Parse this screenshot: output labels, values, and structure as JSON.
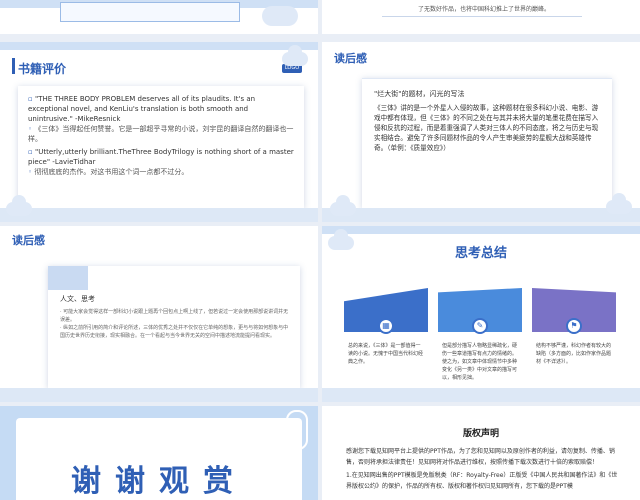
{
  "slides": {
    "top_right": {
      "text": "了无数好作品，也将中国科幻推上了世界的巅峰。"
    },
    "book_review": {
      "title": "书籍评价",
      "logo": "LOGO",
      "quote1_en": "\"THE THREE BODY PROBLEM deserves all of its plaudits. It's an exceptional novel, and KenLiu's translation is both smooth and unintrusive.\"   -MikeResnick",
      "quote1_cn": "《三体》当得起任何赞誉。它是一部超乎寻常的小说，刘宇昆的翻译自然的翻译也一样。",
      "quote2_en": "\"Utterly,utterly brilliant.TheThree BodyTrilogy is nothing short of a master piece\"      -LavieTidhar",
      "quote2_cn": "彻彻底底的杰作。对这书用这个词一点都不过分。"
    },
    "reading_1": {
      "title": "读后感",
      "head": "\"烂大街\"的题材，闪光的写法",
      "body": "《三体》讲的是一个外星人入侵的故事，这种题材在很多科幻小说、电影、游戏中都有体现，但《三体》的不同之处在与其并未将大量的笔墨花费在描写入侵和反抗的过程，而是着重强调了人类对三体人的不同态度，将之与历史与现实相结合。避免了许多同题材作品的令人产生审美疲劳的星舰大战和英雄传奇。（单例：《质量效应》）"
    },
    "reading_2": {
      "title": "读后感",
      "head": "人文、思考",
      "body1": "· 可能大家会觉得这样一部科幻小说跟上题再个回包点上啊上线了，但若说过一定会使用那部说讲词并无误差。",
      "body2": "· 纵如之前所引用的简介和评论所述，三体的优秀之处并不仅仅在它单纯的想象，更与与将如何想象与中国历史世界历史衔接，现实相融合。在一个看起与当今世界无关的空间中描述地流能提问看现实。"
    },
    "summary": {
      "title": "思考总结",
      "cols": [
        {
          "icon": "▦",
          "text": "总的来说，《三体》是一部值得一读的小说。无愧于中国当代科幻经典之作。"
        },
        {
          "icon": "✎",
          "text": "但是部分描写人物略显稀疏化，硬伤一些章道描写有点力的情绪的。使之为，如文章中体现情节中多种变化《另一类》中对文章的描写可以，相形见拙。"
        },
        {
          "icon": "⚑",
          "text": "结构不够严谨，科幻作者有较大的缺陷（多方面的，比如作家作品题材《不详述》）。"
        }
      ]
    },
    "thanks": {
      "text": "谢谢观赏"
    },
    "copyright": {
      "title": "版权声明",
      "p1": "感谢您下载见知网平台上提供的PPT作品，为了您和见知网以及原创作者的利益，请勿复制、传播、销售，否则将承担法律责任！见知网将对作品进行维权，按照传播下载次数进行十倍的索取赔偿！",
      "p2": "1.在见知网出售的PPT模板是免版税类（RF：Royalty-Free）正版受《中国人民共和国著作法》和《世界版权公约》的保护，作品的所有权、版权和著作权归见知网所有，您下载的是PPT模"
    }
  }
}
